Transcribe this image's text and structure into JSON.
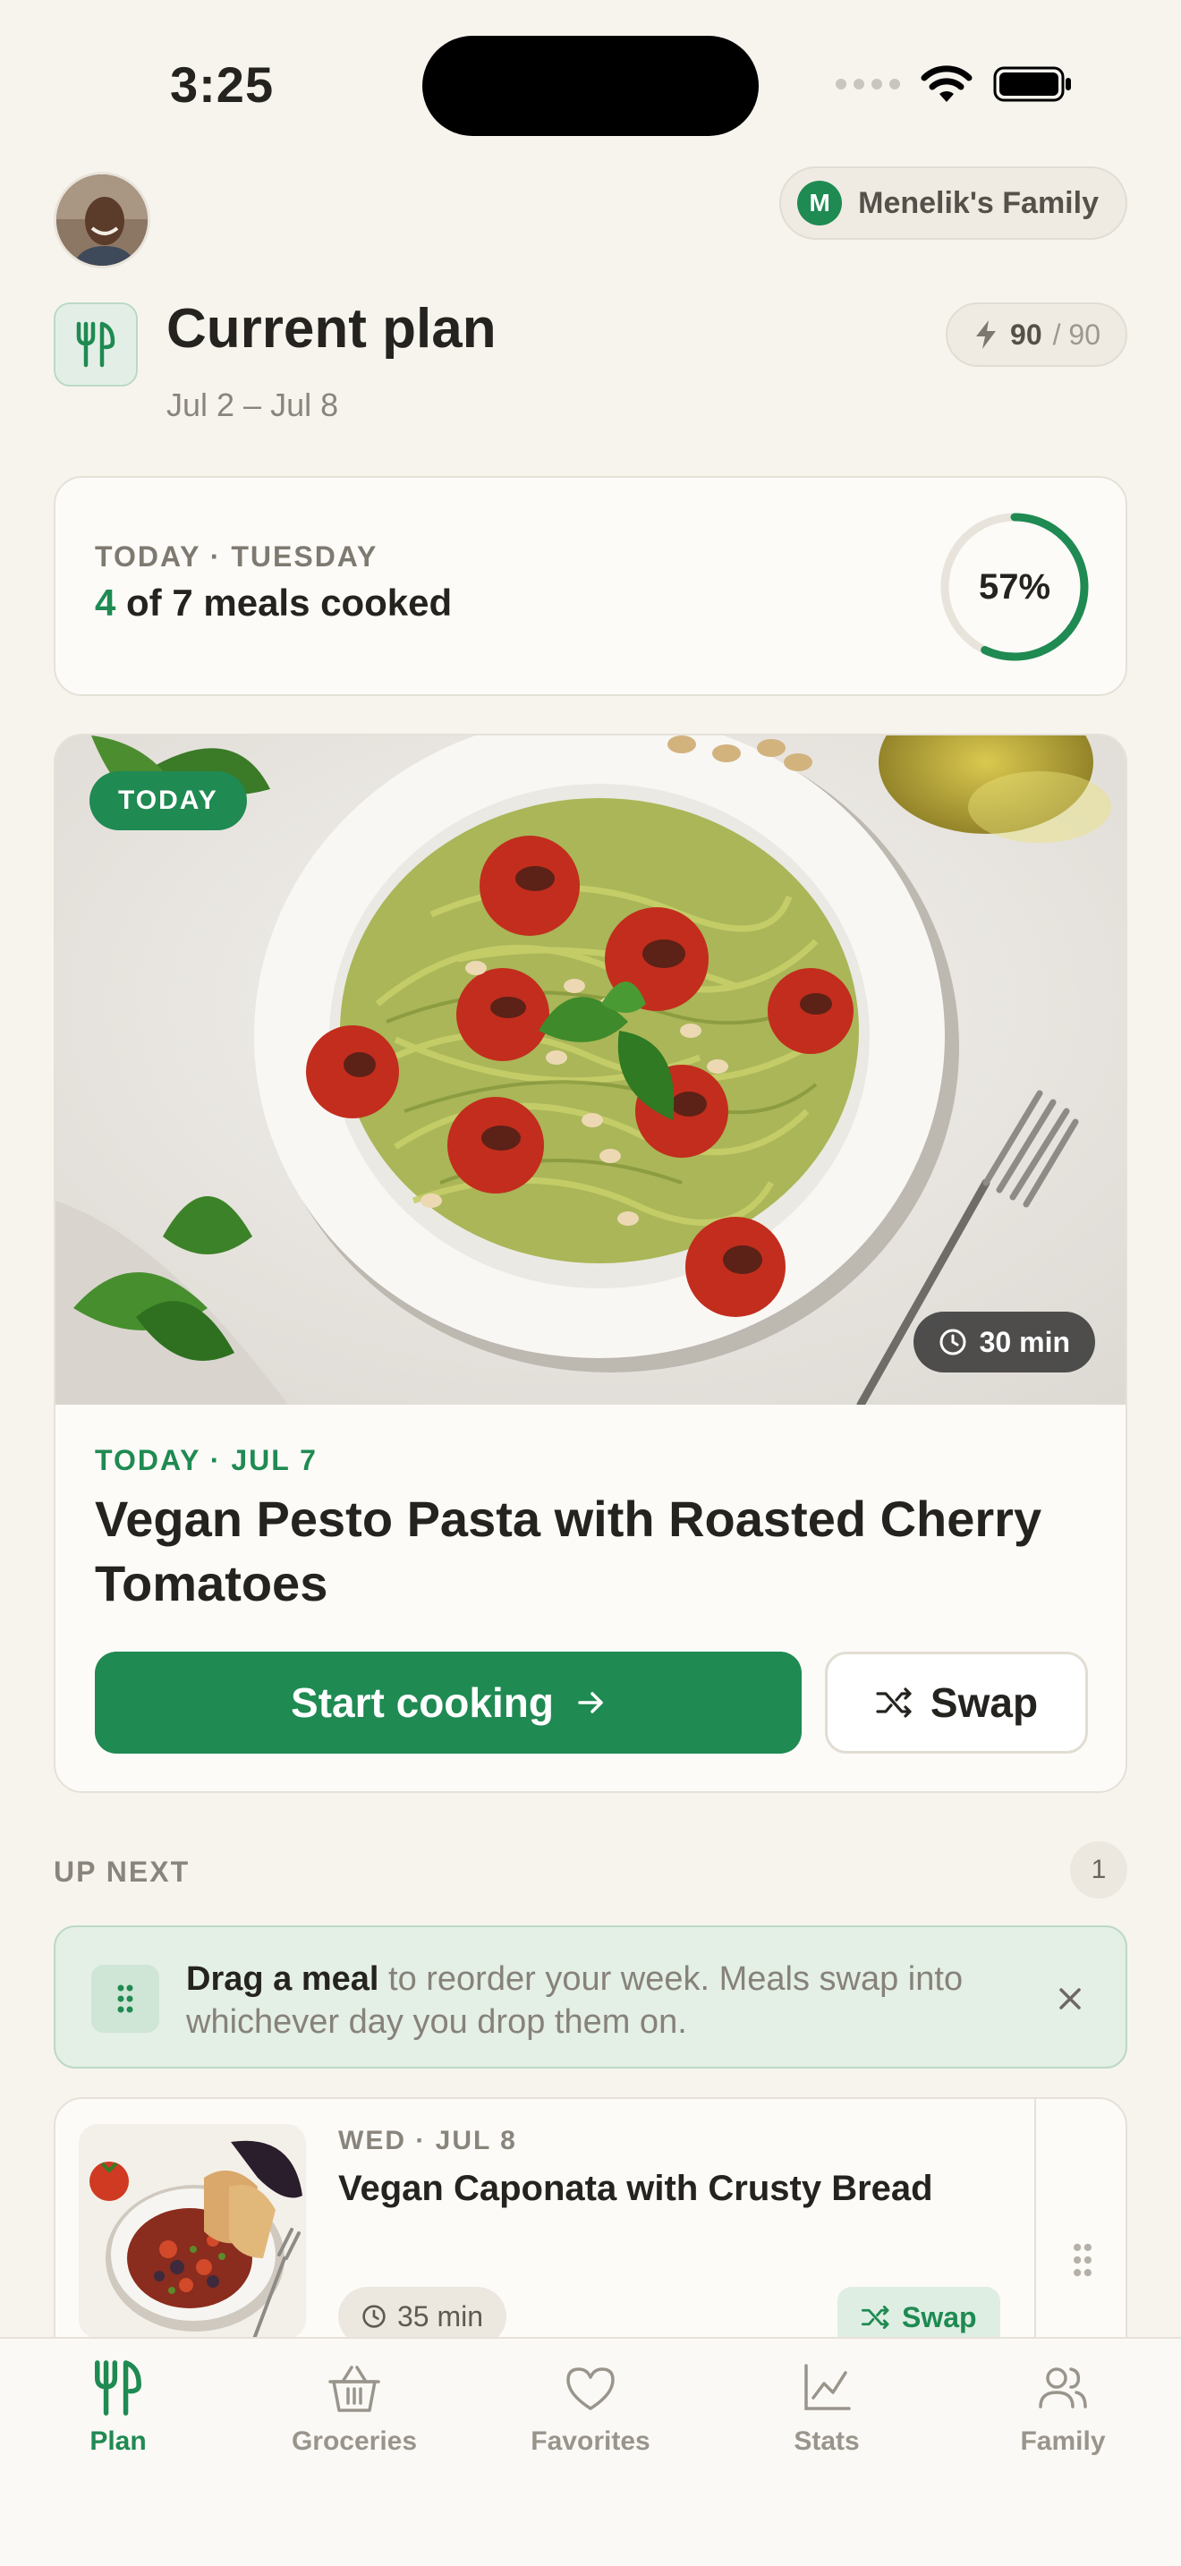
{
  "status_bar": {
    "time": "3:25"
  },
  "header": {
    "family_initial": "M",
    "family_name": "Menelik's Family",
    "title": "Current plan",
    "date_range": "Jul 2 – Jul 8",
    "energy_used": "90",
    "energy_total": "/ 90"
  },
  "progress": {
    "label": "TODAY · TUESDAY",
    "cooked": "4",
    "cooked_suffix": "of 7 meals cooked",
    "percent_text": "57%",
    "percent_value": 57
  },
  "featured_meal": {
    "badge": "TODAY",
    "cook_time": "30 min",
    "date": "TODAY · JUL 7",
    "title": "Vegan Pesto Pasta with Roasted Cherry Tomatoes",
    "start_label": "Start cooking",
    "swap_label": "Swap"
  },
  "up_next": {
    "label": "UP NEXT",
    "count": "1",
    "hint_bold": "Drag a meal",
    "hint_rest": " to reorder your week. Meals swap into whichever day you drop them on.",
    "items": [
      {
        "date": "WED · JUL 8",
        "title": "Vegan Caponata with Crusty Bread",
        "time": "35 min",
        "swap_label": "Swap"
      }
    ]
  },
  "tabs": [
    {
      "label": "Plan",
      "icon": "fork-knife-icon",
      "active": true
    },
    {
      "label": "Groceries",
      "icon": "basket-icon",
      "active": false
    },
    {
      "label": "Favorites",
      "icon": "heart-icon",
      "active": false
    },
    {
      "label": "Stats",
      "icon": "chart-icon",
      "active": false
    },
    {
      "label": "Family",
      "icon": "people-icon",
      "active": false
    }
  ],
  "colors": {
    "accent": "#1f8a52",
    "background": "#f7f4ee",
    "card": "#fcfbf8"
  }
}
